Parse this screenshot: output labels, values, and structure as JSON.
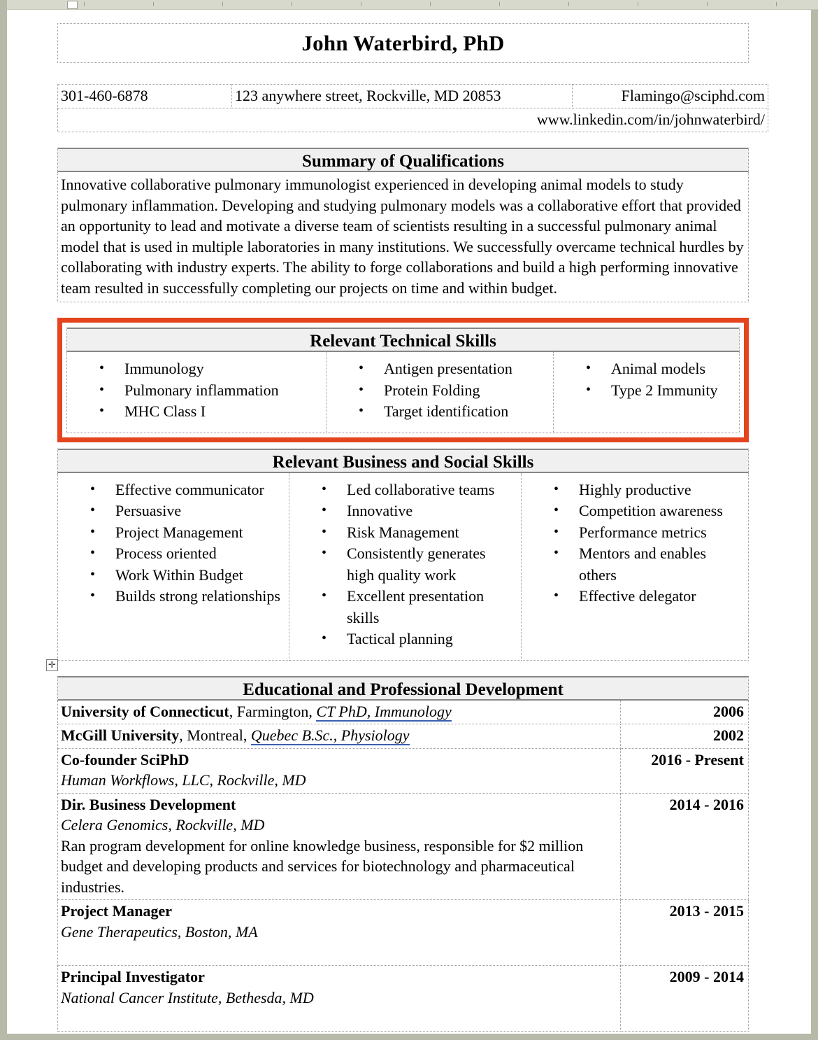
{
  "header": {
    "name": "John Waterbird, PhD"
  },
  "contact": {
    "phone": "301-460-6878",
    "address": "123 anywhere street, Rockville, MD 20853",
    "email": "Flamingo@sciphd.com",
    "linkedin": "www.linkedin.com/in/johnwaterbird/"
  },
  "summary": {
    "title": "Summary of Qualifications",
    "body": "Innovative collaborative pulmonary immunologist experienced in developing animal models to study pulmonary inflammation. Developing and studying pulmonary models was a collaborative effort that provided an opportunity to lead and motivate a diverse team of scientists resulting in a successful pulmonary animal model that is used in multiple laboratories in many institutions. We successfully overcame technical hurdles by collaborating with industry experts. The ability to forge collaborations and build a high performing innovative team resulted in successfully completing our projects on time and within budget."
  },
  "technical_skills": {
    "title": "Relevant Technical Skills",
    "highlight_color": "#e4451e",
    "columns": [
      [
        "Immunology",
        "Pulmonary inflammation",
        "MHC Class I"
      ],
      [
        "Antigen presentation",
        "Protein Folding",
        "Target identification"
      ],
      [
        "Animal models",
        "Type 2 Immunity"
      ]
    ]
  },
  "business_skills": {
    "title": "Relevant Business and Social Skills",
    "columns": [
      [
        "Effective communicator",
        "Persuasive",
        "Project Management",
        "Process oriented",
        "Work Within Budget",
        "Builds strong relationships"
      ],
      [
        "Led collaborative teams",
        "Innovative",
        "Risk Management",
        "Consistently generates high quality work",
        "Excellent presentation skills",
        "Tactical planning"
      ],
      [
        "Highly productive",
        "Competition awareness",
        "Performance metrics",
        "Mentors and enables others",
        "Effective delegator"
      ]
    ]
  },
  "education": {
    "title": "Educational and Professional Development",
    "move_handle_icon": "table-move-handle-icon",
    "entries": [
      {
        "org": "University of Connecticut",
        "org_rest": ", Farmington, ",
        "grammar_text": "CT  PhD, Immunology",
        "date": "2006"
      },
      {
        "org": "McGill University",
        "org_rest": ", Montreal, ",
        "grammar_text": "Quebec  B.Sc., Physiology",
        "date": "2002"
      },
      {
        "role": "Co-founder SciPhD",
        "sub": "Human Workflows, LLC, Rockville, MD",
        "desc": "",
        "date": "2016 - Present"
      },
      {
        "role": "Dir. Business Development",
        "sub": "Celera Genomics, Rockville, MD",
        "desc": "Ran program development for online knowledge business, responsible for $2 million budget and developing products and services for biotechnology and pharmaceutical industries.",
        "date": "2014 - 2016"
      },
      {
        "role": "Project Manager",
        "sub": "Gene Therapeutics, Boston, MA",
        "desc": "",
        "date": "2013 - 2015"
      },
      {
        "role": "Principal Investigator",
        "sub": "National Cancer Institute, Bethesda, MD",
        "desc": "",
        "date": "2009 - 2014"
      }
    ]
  }
}
